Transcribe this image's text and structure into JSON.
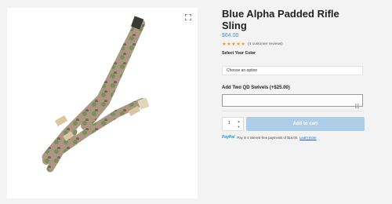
{
  "product": {
    "title": "Blue Alpha Padded Rifle Sling",
    "price": "$64.00",
    "stars": "★★★★★",
    "reviews_text": "(4 customer reviews)"
  },
  "icons": {
    "zoom": "expand-icon",
    "input_helper": "document-icon",
    "qty_up": "chevron-up-icon",
    "qty_down": "chevron-down-icon"
  },
  "options": {
    "color_label": "Select Your Color",
    "color_value": "Choose an option",
    "swivel_label": "Add Two QD Swivels (+$25.00)",
    "swivel_value": ""
  },
  "purchase": {
    "quantity": "1",
    "add_to_cart": "Add to cart"
  },
  "paypal": {
    "logo_pay": "Pay",
    "logo_pal": "Pal",
    "message": "Pay in 4 interest-free payments of $16.00.",
    "link": "Learn more"
  },
  "colors": {
    "accent_price": "#4f94c9",
    "button_bg": "#aecde6",
    "star": "#f2a21b"
  }
}
